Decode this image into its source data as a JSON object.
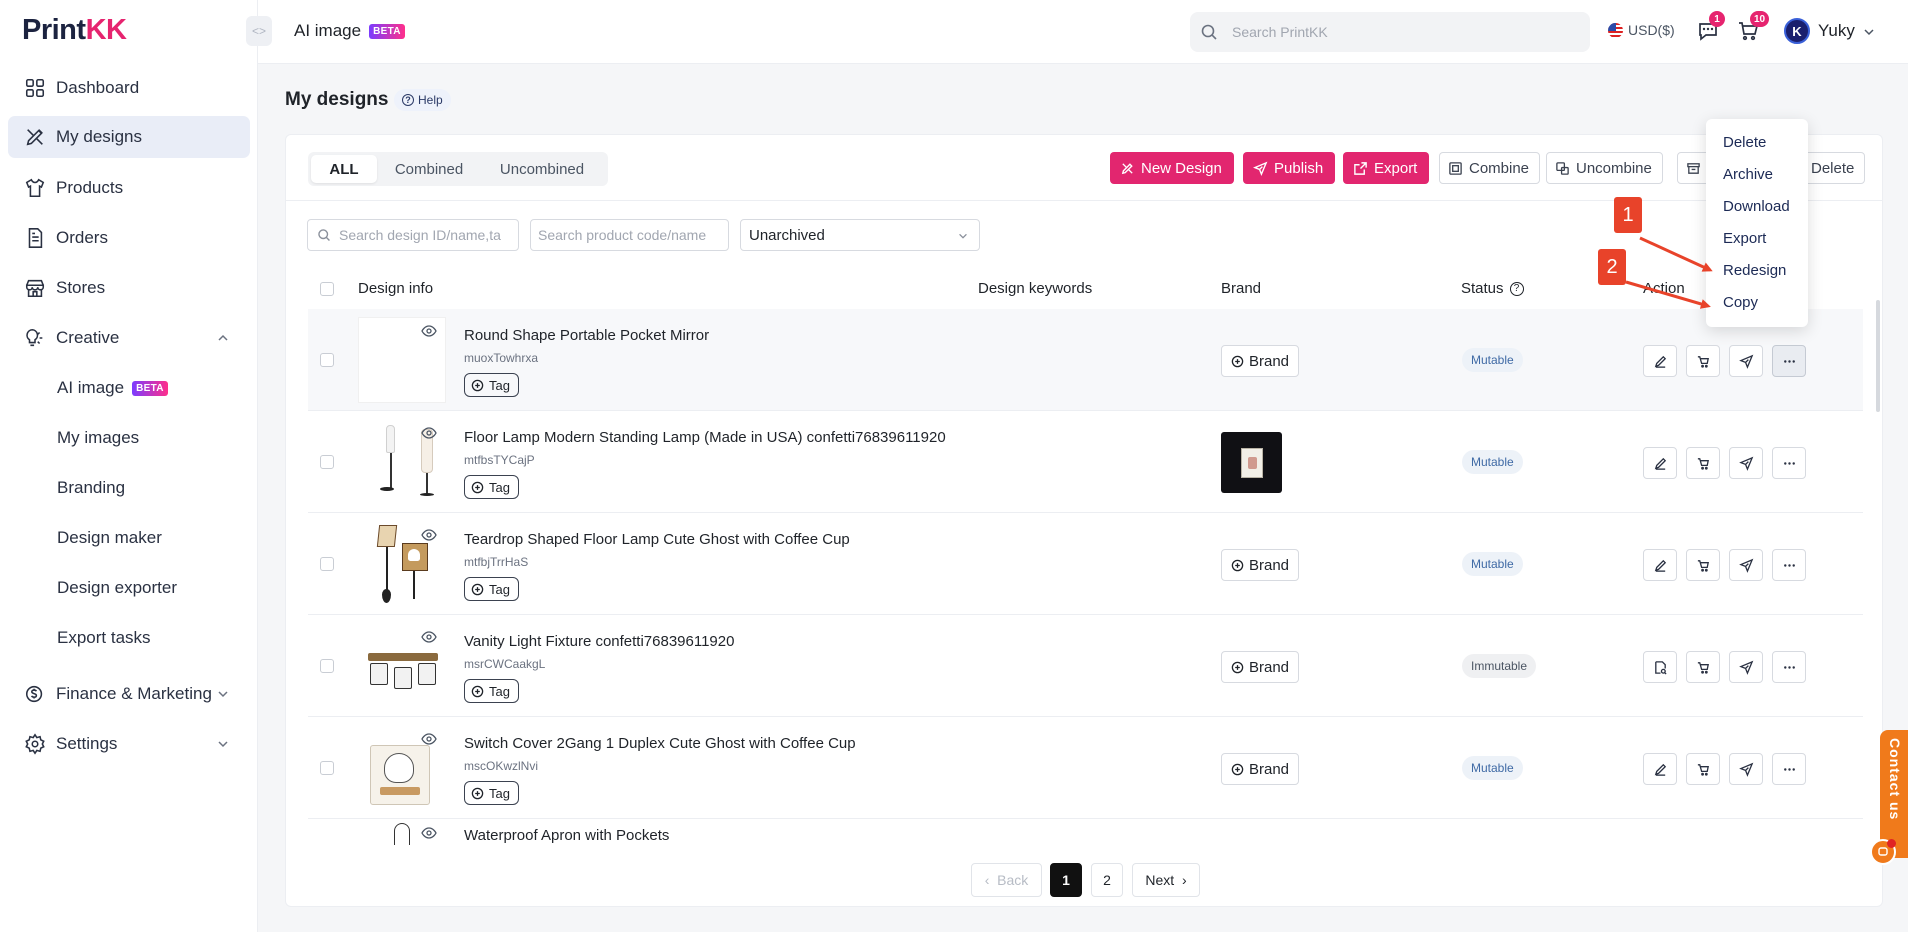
{
  "brand": {
    "logo_main": "Print",
    "logo_accent": "KK"
  },
  "sidebar": {
    "items": [
      {
        "label": "Dashboard",
        "icon": "dashboard-icon"
      },
      {
        "label": "My designs",
        "icon": "designs-icon"
      },
      {
        "label": "Products",
        "icon": "tshirt-icon"
      },
      {
        "label": "Orders",
        "icon": "orders-icon"
      },
      {
        "label": "Stores",
        "icon": "store-icon"
      },
      {
        "label": "Creative",
        "icon": "creative-icon"
      }
    ],
    "creative_sub": [
      {
        "label": "AI image",
        "badge": "BETA"
      },
      {
        "label": "My images"
      },
      {
        "label": "Branding"
      },
      {
        "label": "Design maker"
      },
      {
        "label": "Design exporter"
      },
      {
        "label": "Export tasks"
      }
    ],
    "bottom": [
      {
        "label": "Finance & Marketing",
        "icon": "finance-icon"
      },
      {
        "label": "Settings",
        "icon": "gear-icon"
      }
    ]
  },
  "header": {
    "crumb": "AI image",
    "crumb_badge": "BETA",
    "search_placeholder": "Search PrintKK",
    "currency": "USD($)",
    "messages_count": "1",
    "cart_count": "10",
    "avatar_letter": "K",
    "user_name": "Yuky"
  },
  "page": {
    "title": "My designs",
    "help": "Help"
  },
  "tabs": [
    "ALL",
    "Combined",
    "Uncombined"
  ],
  "toolbar": {
    "new_design": "New Design",
    "publish": "Publish",
    "export": "Export",
    "combine": "Combine",
    "uncombine": "Uncombine",
    "delete": "Delete"
  },
  "filters": {
    "design_search_placeholder": "Search design ID/name,ta",
    "product_search_placeholder": "Search product code/name",
    "archive_select": "Unarchived"
  },
  "columns": {
    "design_info": "Design info",
    "keywords": "Design keywords",
    "brand": "Brand",
    "status": "Status",
    "action": "Action"
  },
  "rows": [
    {
      "name": "Round Shape Portable Pocket Mirror",
      "id": "muoxTowhrxa",
      "tag": "Tag",
      "brand": "Brand",
      "status": "Mutable"
    },
    {
      "name": "Floor Lamp Modern Standing Lamp (Made in USA) confetti76839611920",
      "id": "mtfbsTYCajP",
      "tag": "Tag",
      "brand": "",
      "status": "Mutable"
    },
    {
      "name": "Teardrop Shaped Floor Lamp Cute Ghost with Coffee Cup",
      "id": "mtfbjTrrHaS",
      "tag": "Tag",
      "brand": "Brand",
      "status": "Mutable"
    },
    {
      "name": "Vanity Light Fixture confetti76839611920",
      "id": "msrCWCaakgL",
      "tag": "Tag",
      "brand": "Brand",
      "status": "Immutable"
    },
    {
      "name": "Switch Cover 2Gang 1 Duplex Cute Ghost with Coffee Cup",
      "id": "mscOKwzlNvi",
      "tag": "Tag",
      "brand": "Brand",
      "status": "Mutable"
    },
    {
      "name": "Waterproof Apron with Pockets"
    }
  ],
  "pagination": {
    "back": "Back",
    "pages": [
      "1",
      "2"
    ],
    "next": "Next"
  },
  "menu": [
    "Delete",
    "Archive",
    "Download",
    "Export",
    "Redesign",
    "Copy"
  ],
  "annotations": [
    "1",
    "2"
  ],
  "contact": "Contact us",
  "colors": {
    "primary": "#e2266f",
    "annotation": "#e8432a",
    "contact": "#f07a1b"
  }
}
